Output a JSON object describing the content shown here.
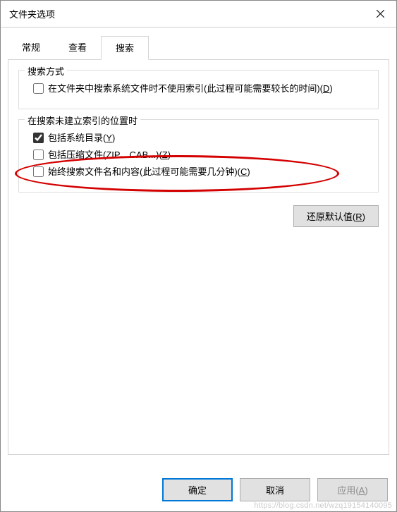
{
  "window": {
    "title": "文件夹选项"
  },
  "tabs": [
    {
      "label": "常规",
      "active": false
    },
    {
      "label": "查看",
      "active": false
    },
    {
      "label": "搜索",
      "active": true
    }
  ],
  "group1": {
    "legend": "搜索方式",
    "opt_d": {
      "checked": false,
      "text_pre": "在文件夹中搜索系统文件时不使用索引(此过程可能需要较长的时间)(",
      "hotkey": "D",
      "text_post": ")"
    }
  },
  "group2": {
    "legend": "在搜索未建立索引的位置时",
    "opt_y": {
      "checked": true,
      "text_pre": "包括系统目录(",
      "hotkey": "Y",
      "text_post": ")"
    },
    "opt_z": {
      "checked": false,
      "text_pre": "包括压缩文件(ZIP、CAB...)(",
      "hotkey": "Z",
      "text_post": ")"
    },
    "opt_c": {
      "checked": false,
      "text_pre": "始终搜索文件名和内容(此过程可能需要几分钟)(",
      "hotkey": "C",
      "text_post": ")"
    }
  },
  "buttons": {
    "restore_pre": "还原默认值(",
    "restore_hotkey": "R",
    "restore_post": ")",
    "ok": "确定",
    "cancel": "取消",
    "apply_pre": "应用(",
    "apply_hotkey": "A",
    "apply_post": ")"
  },
  "watermark": "https://blog.csdn.net/wzq19154140095"
}
